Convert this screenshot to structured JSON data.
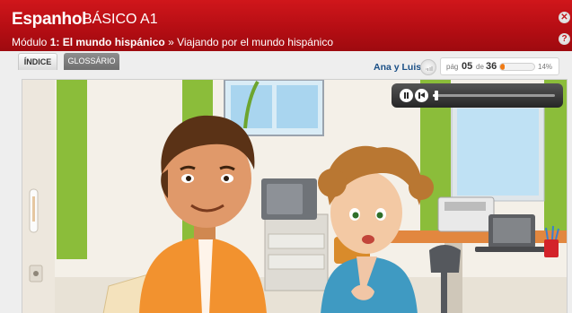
{
  "header": {
    "course_name": "Espanhol",
    "course_level": "BÁSICO A1",
    "module_label": "Módulo",
    "module_title": "1: El mundo hispánico",
    "separator": "»",
    "lesson_title": "Viajando por el mundo hispánico"
  },
  "tabs": [
    {
      "label": "ÍNDICE"
    },
    {
      "label": "GLOSSÁRIO"
    }
  ],
  "info": {
    "characters": "Ana y Luis",
    "page_label": "pág",
    "current_page": "05",
    "of_label": "de",
    "total_pages": "36",
    "progress_text": "14%",
    "progress_fraction": 0.14
  },
  "player": {
    "seek_fraction": 0.03
  },
  "icons": [
    "close-icon",
    "help-icon",
    "volume-icon",
    "pause-icon",
    "rewind-icon"
  ],
  "colors": {
    "header_red": "#c0151a",
    "progress_orange": "#f07a14",
    "title_blue": "#1a4f86"
  }
}
